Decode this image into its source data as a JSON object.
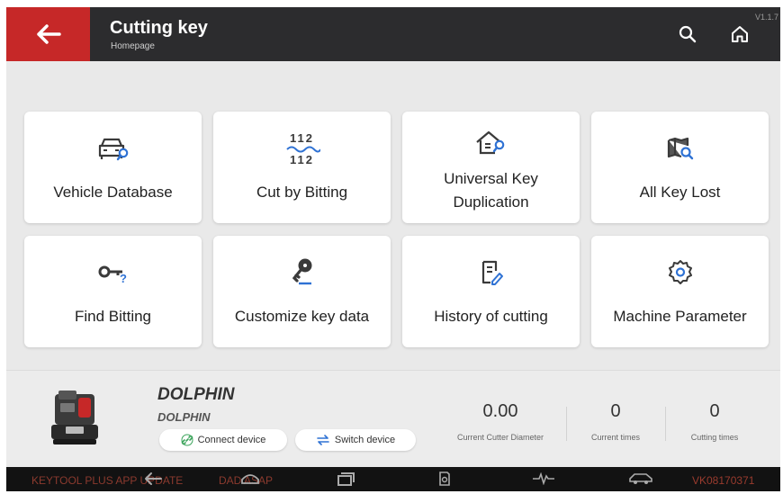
{
  "header": {
    "title": "Cutting key",
    "subtitle": "Homepage",
    "version": "V1.1.7",
    "back_icon": "arrow-left-icon",
    "search_icon": "search-icon",
    "home_icon": "home-icon",
    "accent_color": "#c62828"
  },
  "tiles": [
    {
      "label": "Vehicle Database",
      "icon": "car-search-icon"
    },
    {
      "label": "Cut by Bitting",
      "icon": "bitting-icon",
      "icon_text_top": "112",
      "icon_text_bottom": "112"
    },
    {
      "label": "Universal Key Duplication",
      "icon": "house-key-search-icon"
    },
    {
      "label": "All Key Lost",
      "icon": "map-search-icon"
    },
    {
      "label": "Find Bitting",
      "icon": "key-question-icon"
    },
    {
      "label": "Customize key data",
      "icon": "key-edit-icon"
    },
    {
      "label": "History of cutting",
      "icon": "document-edit-icon"
    },
    {
      "label": "Machine Parameter",
      "icon": "gear-icon"
    }
  ],
  "device": {
    "name": "DOLPHIN",
    "model": "DOLPHIN",
    "connect_label": "Connect device",
    "switch_label": "Switch device",
    "stats": [
      {
        "value": "0.00",
        "label": "Current Cutter Diameter"
      },
      {
        "value": "0",
        "label": "Current times"
      },
      {
        "value": "0",
        "label": "Cutting times"
      }
    ]
  },
  "navbar": {
    "left_text": "KEYTOOL PLUS APP UPDATE",
    "mid_text": "DAD ASAP",
    "serial": "VK08170371",
    "icons": [
      "back-icon",
      "car-top-icon",
      "recent-apps-icon",
      "document-search-icon",
      "pulse-icon",
      "car-side-icon"
    ]
  }
}
